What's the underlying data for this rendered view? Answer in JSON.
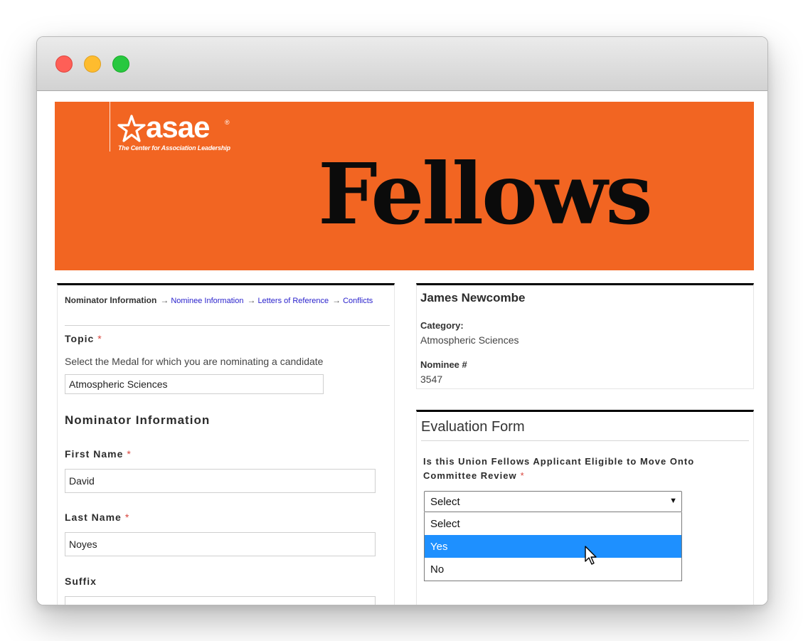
{
  "banner": {
    "logo": "asae",
    "logo_registered": "®",
    "tagline": "The Center for Association Leadership",
    "title": "Fellows",
    "color": "#f26522"
  },
  "steps": {
    "current": "Nominator Information",
    "links": [
      "Nominee Information",
      "Letters of Reference",
      "Conflicts"
    ]
  },
  "form": {
    "topic_label": "Topic",
    "topic_help": "Select the Medal for which you are nominating a candidate",
    "topic_value": "Atmospheric Sciences",
    "section_heading": "Nominator Information",
    "first_name_label": "First Name",
    "first_name_value": "David",
    "last_name_label": "Last Name",
    "last_name_value": "Noyes",
    "suffix_label": "Suffix",
    "suffix_value": "",
    "required_marker": "*"
  },
  "nominee": {
    "name": "James Newcombe",
    "category_label": "Category:",
    "category_value": "Atmospheric Sciences",
    "number_label": "Nominee #",
    "number_value": "3547"
  },
  "evaluation": {
    "title": "Evaluation Form",
    "question": "Is this Union Fellows Applicant Eligible to Move Onto Committee Review",
    "select_value": "Select",
    "options": [
      "Select",
      "Yes",
      "No"
    ],
    "highlighted_option": "Yes",
    "highlight_color": "#1e90ff"
  }
}
